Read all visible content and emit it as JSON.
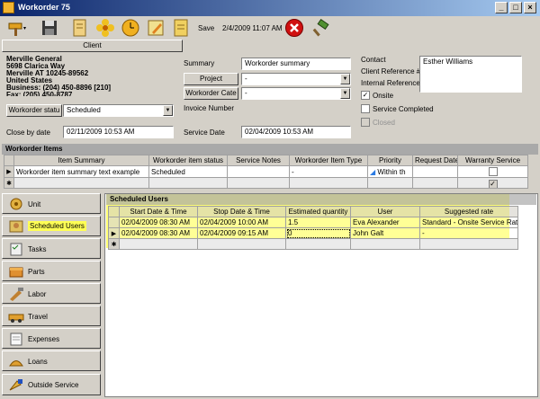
{
  "window": {
    "title": "Workorder 75",
    "controls": [
      "_",
      "□",
      "×"
    ]
  },
  "toolbar": {
    "save_label": "Save",
    "datetime": "2/4/2009 11:07 AM"
  },
  "client": {
    "button_label": "Client",
    "address_lines": [
      "Merville General",
      "5698 Clarica Way",
      "Merville AT  10245-89562",
      "United States",
      "Business: (204) 450-8896 [210]",
      "Fax: (205) 450-8787"
    ]
  },
  "form": {
    "summary_label": "Summary",
    "summary_value": "Workorder summary",
    "project_label": "Project",
    "project_value": "-",
    "category_label": "Workorder Cate",
    "category_value": "-",
    "invoice_label": "Invoice Number",
    "status_label": "Workorder statu",
    "status_value": "Scheduled",
    "close_label": "Close by date",
    "close_value": "02/11/2009 10:53 AM",
    "service_date_label": "Service Date",
    "service_date_value": "02/04/2009 10:53 AM",
    "contact_label": "Contact",
    "contact_value": "Esther Williams",
    "client_ref_label": "Client Reference #",
    "internal_ref_label": "Internal Reference",
    "onsite_label": "Onsite",
    "service_completed_label": "Service Completed",
    "closed_label": "Closed",
    "onsite_checked": "✓"
  },
  "items": {
    "section_title": "Workorder Items",
    "headers": [
      "Item Summary",
      "Workorder item status",
      "Service Notes",
      "Workorder Item Type",
      "Priority",
      "Request Date",
      "Warranty Service"
    ],
    "row": {
      "summary": "Workorder item summary text example",
      "status": "Scheduled",
      "notes": "",
      "type": "-",
      "priority": "Within th",
      "request_date": "",
      "warranty": ""
    },
    "new_row_warranty": "✓"
  },
  "nav": {
    "items": [
      {
        "label": "Unit",
        "icon": "unit-icon"
      },
      {
        "label": "Scheduled Users",
        "icon": "scheduled-users-icon"
      },
      {
        "label": "Tasks",
        "icon": "tasks-icon"
      },
      {
        "label": "Parts",
        "icon": "parts-icon"
      },
      {
        "label": "Labor",
        "icon": "labor-icon"
      },
      {
        "label": "Travel",
        "icon": "travel-icon"
      },
      {
        "label": "Expenses",
        "icon": "expenses-icon"
      },
      {
        "label": "Loans",
        "icon": "loans-icon"
      },
      {
        "label": "Outside Service",
        "icon": "outside-service-icon"
      }
    ]
  },
  "scheduled": {
    "section_title": "Scheduled Users",
    "headers": [
      "Start Date & Time",
      "Stop Date & Time",
      "Estimated quantity",
      "User",
      "Suggested rate"
    ],
    "rows": [
      {
        "start": "02/04/2009 08:30 AM",
        "stop": "02/04/2009 10:00 AM",
        "qty": "1.5",
        "user": "Eva Alexander",
        "rate": "Standard - Onsite Service Rate"
      },
      {
        "start": "02/04/2009 08:30 AM",
        "stop": "02/04/2009 09:15 AM",
        "qty": "0",
        "user": "John Galt",
        "rate": "-"
      }
    ]
  },
  "colors": {
    "highlight": "#ffff00",
    "titlebar": "#0a246a"
  }
}
